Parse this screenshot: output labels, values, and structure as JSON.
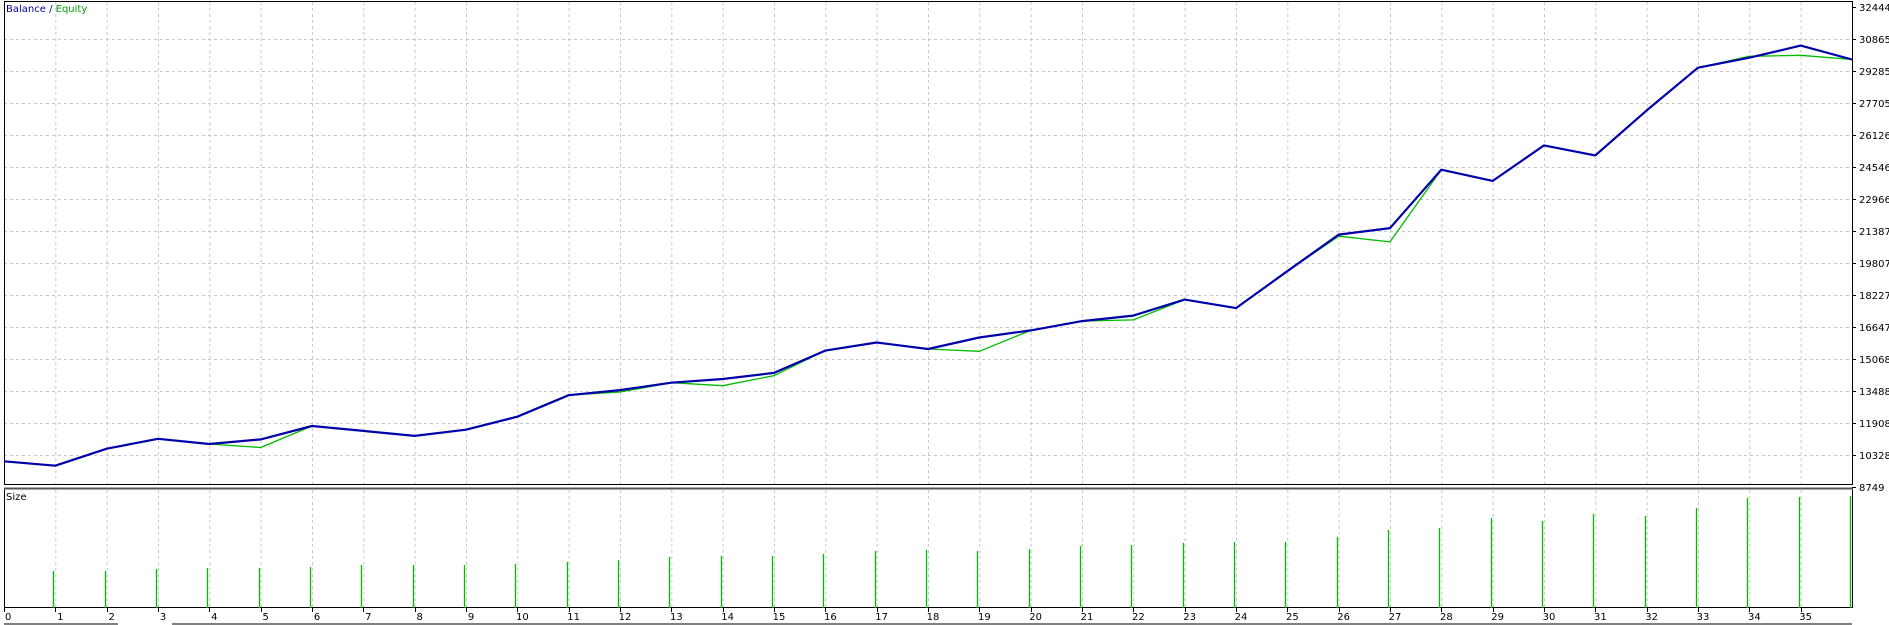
{
  "chart_data": [
    {
      "type": "line",
      "legend": {
        "balance_label": "Balance",
        "separator": " / ",
        "equity_label": "Equity",
        "placement": "top-left"
      },
      "colors": {
        "balance": "#0000aa",
        "equity": "#00bb00",
        "grid": "#c8c8c8"
      },
      "grid": true,
      "ylim": [
        8749,
        32444
      ],
      "y_ticks": [
        8749,
        10328,
        11908,
        13488,
        15068,
        16647,
        18227,
        19807,
        21387,
        22966,
        24546,
        26126,
        27705,
        29285,
        30865,
        32444
      ],
      "x": [
        0,
        1,
        2,
        3,
        4,
        5,
        6,
        7,
        8,
        9,
        10,
        11,
        12,
        13,
        14,
        15,
        16,
        17,
        18,
        19,
        20,
        21,
        22,
        23,
        24,
        25,
        26,
        27,
        28,
        29,
        30,
        31,
        32,
        33,
        34,
        35,
        36
      ],
      "series": [
        {
          "name": "Balance",
          "values": [
            10020,
            9800,
            10640,
            11130,
            10870,
            11100,
            11760,
            11520,
            11270,
            11580,
            12220,
            13280,
            13530,
            13900,
            14080,
            14380,
            15480,
            15880,
            15560,
            16130,
            16480,
            16940,
            17210,
            18000,
            17580,
            19400,
            21210,
            21530,
            24410,
            23860,
            25610,
            25120,
            27340,
            29450,
            29940,
            30540,
            29850
          ]
        },
        {
          "name": "Equity",
          "values": [
            10020,
            9800,
            10640,
            11130,
            10870,
            10700,
            11760,
            11520,
            11270,
            11580,
            12220,
            13280,
            13440,
            13900,
            13750,
            14250,
            15480,
            15880,
            15560,
            15450,
            16480,
            16940,
            17000,
            18000,
            17580,
            19400,
            21130,
            20850,
            24410,
            23860,
            25610,
            25120,
            27340,
            29450,
            30010,
            30060,
            29850
          ]
        }
      ]
    },
    {
      "type": "bar",
      "title": "Size",
      "color": "#00bb00",
      "x_ticks": [
        "0",
        "1",
        "2",
        "3",
        "4",
        "5",
        "6",
        "7",
        "8",
        "9",
        "10",
        "11",
        "12",
        "13",
        "14",
        "15",
        "16",
        "17",
        "18",
        "19",
        "20",
        "21",
        "22",
        "23",
        "24",
        "25",
        "26",
        "27",
        "28",
        "29",
        "30",
        "31",
        "32",
        "33",
        "34",
        "35"
      ],
      "x": [
        1,
        2,
        3,
        4,
        5,
        6,
        7,
        8,
        9,
        10,
        11,
        12,
        13,
        14,
        15,
        16,
        17,
        18,
        19,
        20,
        21,
        22,
        23,
        24,
        25,
        26,
        27,
        28,
        29,
        30,
        31,
        32,
        33,
        34,
        35,
        36
      ],
      "values": [
        0.37,
        0.37,
        0.39,
        0.4,
        0.4,
        0.41,
        0.43,
        0.43,
        0.43,
        0.44,
        0.46,
        0.48,
        0.51,
        0.52,
        0.52,
        0.54,
        0.57,
        0.58,
        0.57,
        0.59,
        0.62,
        0.63,
        0.65,
        0.66,
        0.66,
        0.71,
        0.78,
        0.8,
        0.9,
        0.87,
        0.94,
        0.92,
        1.0,
        1.1,
        1.11,
        1.12
      ],
      "ylim": [
        0,
        1.12
      ]
    }
  ]
}
